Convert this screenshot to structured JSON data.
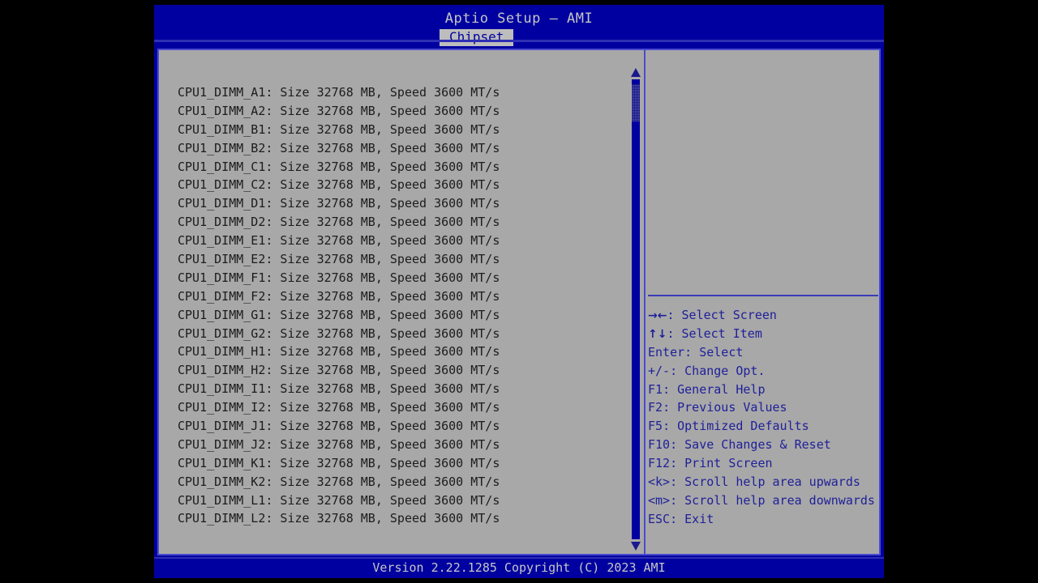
{
  "window": {
    "app_title": "Aptio Setup – AMI",
    "active_tab": "Chipset"
  },
  "tabs": [
    {
      "label": "Chipset",
      "active": true
    }
  ],
  "main": {
    "dimm_rows": [
      "CPU1_DIMM_A1: Size 32768 MB, Speed 3600 MT/s",
      "CPU1_DIMM_A2: Size 32768 MB, Speed 3600 MT/s",
      "CPU1_DIMM_B1: Size 32768 MB, Speed 3600 MT/s",
      "CPU1_DIMM_B2: Size 32768 MB, Speed 3600 MT/s",
      "CPU1_DIMM_C1: Size 32768 MB, Speed 3600 MT/s",
      "CPU1_DIMM_C2: Size 32768 MB, Speed 3600 MT/s",
      "CPU1_DIMM_D1: Size 32768 MB, Speed 3600 MT/s",
      "CPU1_DIMM_D2: Size 32768 MB, Speed 3600 MT/s",
      "CPU1_DIMM_E1: Size 32768 MB, Speed 3600 MT/s",
      "CPU1_DIMM_E2: Size 32768 MB, Speed 3600 MT/s",
      "CPU1_DIMM_F1: Size 32768 MB, Speed 3600 MT/s",
      "CPU1_DIMM_F2: Size 32768 MB, Speed 3600 MT/s",
      "CPU1_DIMM_G1: Size 32768 MB, Speed 3600 MT/s",
      "CPU1_DIMM_G2: Size 32768 MB, Speed 3600 MT/s",
      "CPU1_DIMM_H1: Size 32768 MB, Speed 3600 MT/s",
      "CPU1_DIMM_H2: Size 32768 MB, Speed 3600 MT/s",
      "CPU1_DIMM_I1: Size 32768 MB, Speed 3600 MT/s",
      "CPU1_DIMM_I2: Size 32768 MB, Speed 3600 MT/s",
      "CPU1_DIMM_J1: Size 32768 MB, Speed 3600 MT/s",
      "CPU1_DIMM_J2: Size 32768 MB, Speed 3600 MT/s",
      "CPU1_DIMM_K1: Size 32768 MB, Speed 3600 MT/s",
      "CPU1_DIMM_K2: Size 32768 MB, Speed 3600 MT/s",
      "CPU1_DIMM_L1: Size 32768 MB, Speed 3600 MT/s",
      "CPU1_DIMM_L2: Size 32768 MB, Speed 3600 MT/s"
    ]
  },
  "scrollbar": {
    "up_arrow_icon": "triangle-up-icon",
    "down_arrow_icon": "triangle-down-icon"
  },
  "help": {
    "legend": [
      {
        "key": "→←",
        "text": ": Select Screen",
        "glyph": true
      },
      {
        "key": "↑↓",
        "text": ": Select Item",
        "glyph": true
      },
      {
        "key": "Enter",
        "text": ": Select",
        "glyph": false
      },
      {
        "key": "+/-",
        "text": ": Change Opt.",
        "glyph": false
      },
      {
        "key": "F1",
        "text": ": General Help",
        "glyph": false
      },
      {
        "key": "F2",
        "text": ": Previous Values",
        "glyph": false
      },
      {
        "key": "F5",
        "text": ": Optimized Defaults",
        "glyph": false
      },
      {
        "key": "F10",
        "text": ": Save Changes & Reset",
        "glyph": false
      },
      {
        "key": "F12",
        "text": ": Print Screen",
        "glyph": false
      },
      {
        "key": "<k>",
        "text": ": Scroll help area upwards",
        "glyph": false
      },
      {
        "key": "<m>",
        "text": ": Scroll help area downwards",
        "glyph": false
      },
      {
        "key": "ESC",
        "text": ": Exit",
        "glyph": false
      }
    ]
  },
  "footer": {
    "version_text": "Version 2.22.1285 Copyright (C) 2023 AMI"
  },
  "colors": {
    "title_blue": "#0000a0",
    "panel_gray": "#a8a8a8",
    "tab_gray": "#bdbdbd",
    "legend_blue": "#20209a",
    "border_blue": "#4b4bd0",
    "text_dark": "#1c1c1c",
    "text_light": "#c6c6c6"
  }
}
